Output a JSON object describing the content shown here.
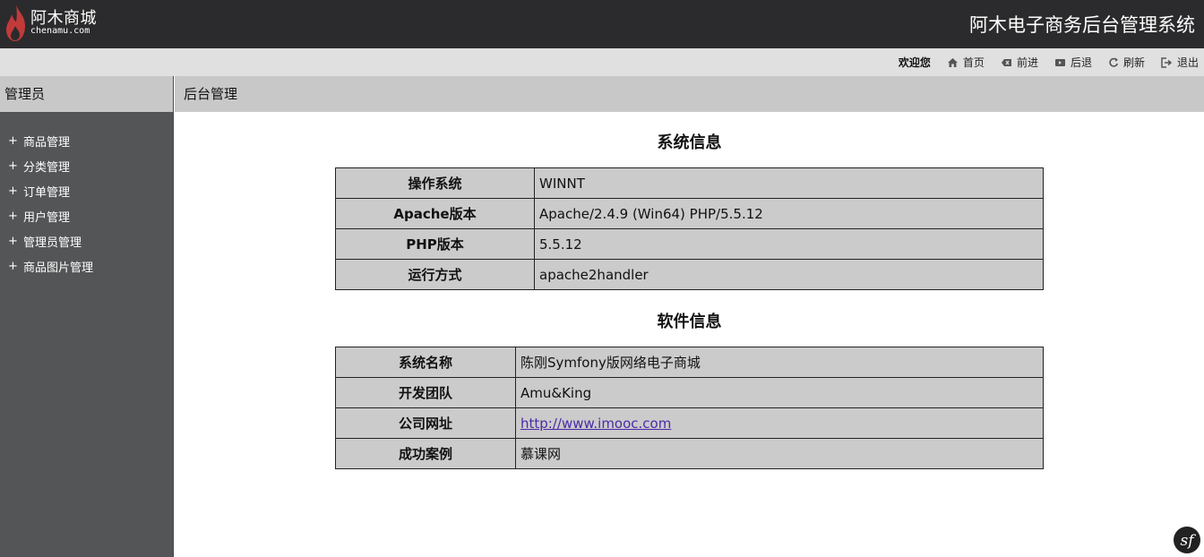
{
  "header": {
    "logo_title": "阿木商城",
    "logo_subtitle": "chenamu.com",
    "system_title": "阿木电子商务后台管理系统"
  },
  "nav": {
    "welcome": "欢迎您",
    "items": [
      {
        "label": "首页",
        "icon": "home-icon"
      },
      {
        "label": "前进",
        "icon": "forward-icon"
      },
      {
        "label": "后退",
        "icon": "back-icon"
      },
      {
        "label": "刷新",
        "icon": "refresh-icon"
      },
      {
        "label": "退出",
        "icon": "logout-icon"
      }
    ]
  },
  "sidebar": {
    "heading": "管理员",
    "items": [
      {
        "label": "商品管理"
      },
      {
        "label": "分类管理"
      },
      {
        "label": "订单管理"
      },
      {
        "label": "用户管理"
      },
      {
        "label": "管理员管理"
      },
      {
        "label": "商品图片管理"
      }
    ]
  },
  "main": {
    "heading": "后台管理",
    "system_info": {
      "title": "系统信息",
      "rows": [
        {
          "key": "操作系统",
          "value": "WINNT"
        },
        {
          "key": "Apache版本",
          "value": "Apache/2.4.9 (Win64) PHP/5.5.12"
        },
        {
          "key": "PHP版本",
          "value": "5.5.12"
        },
        {
          "key": "运行方式",
          "value": "apache2handler"
        }
      ]
    },
    "software_info": {
      "title": "软件信息",
      "rows": [
        {
          "key": "系统名称",
          "value": "陈刚Symfony版网络电子商城"
        },
        {
          "key": "开发团队",
          "value": "Amu&King"
        },
        {
          "key": "公司网址",
          "value": "http://www.imooc.com"
        },
        {
          "key": "成功案例",
          "value": "慕课网"
        }
      ]
    }
  },
  "colors": {
    "topbar": "#2b2b2d",
    "navbar": "#e0e0e0",
    "sidebar": "#545557",
    "table_bg": "#cbcbcb",
    "logo_flame": "#c23a3a"
  },
  "debug_badge_icon": "symfony-icon"
}
